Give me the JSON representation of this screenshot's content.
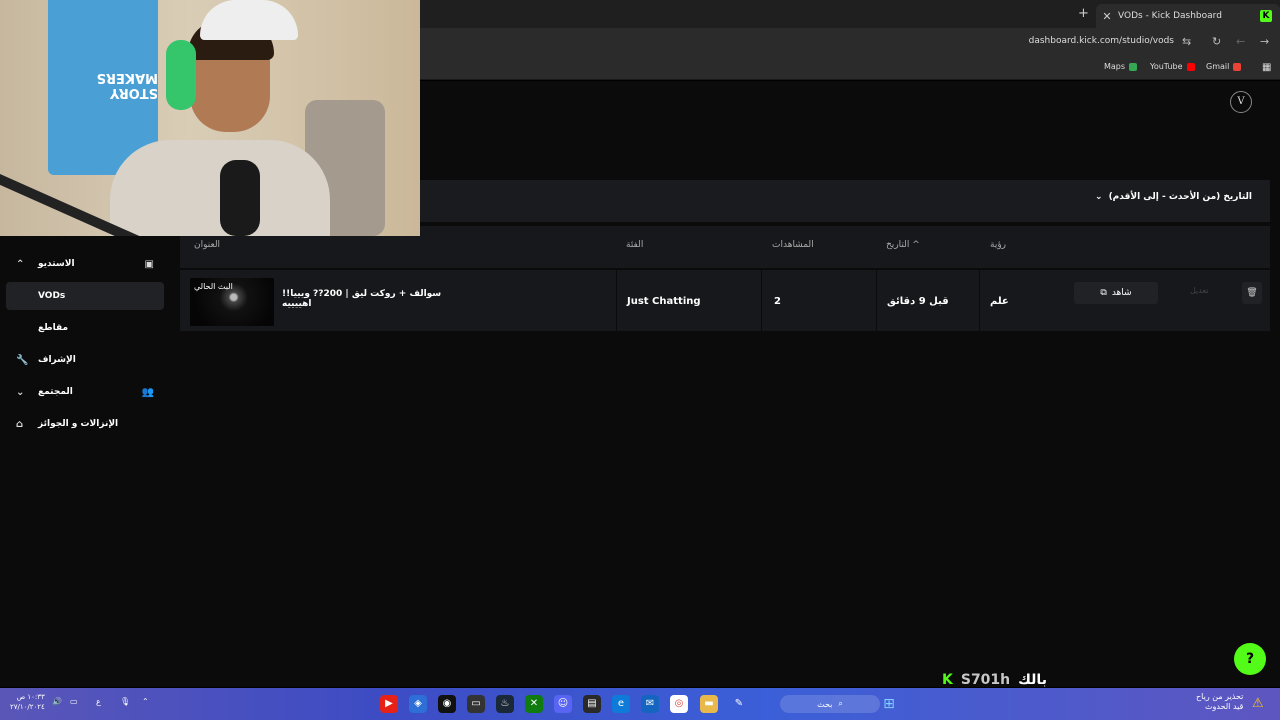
{
  "browser": {
    "tab_title": "VODs - Kick Dashboard",
    "tab_favicon": "K",
    "new_tab": "+",
    "tab_close": "✕",
    "url": "dashboard.kick.com/studio/vods",
    "bookmarks": [
      {
        "label": "Maps",
        "color": "#34a853"
      },
      {
        "label": "YouTube",
        "color": "#ff0000"
      },
      {
        "label": "Gmail",
        "color": "#ea4335"
      }
    ]
  },
  "header": {
    "avatar": "V"
  },
  "filter": {
    "sort_label": "التاريخ (من الأحدث - إلى الأقدم)"
  },
  "table": {
    "columns": {
      "title": "العنوان",
      "category": "الفئة",
      "views": "المشاهدات",
      "date": "التاريخ",
      "visibility": "رؤية"
    },
    "rows": [
      {
        "thumb_label": "البث الحالي",
        "title": "سوالف + روكت ليق | 200?? ويييا!!اهييييه",
        "category": "Just Chatting",
        "views": "2",
        "date": "قبل 9 دقائق",
        "visibility": "علم",
        "watch": "شاهد",
        "edit": "تعديل"
      }
    ]
  },
  "sidebar": {
    "items": [
      {
        "label": "الاستديو"
      },
      {
        "label": "VODs"
      },
      {
        "label": "مقاطع"
      },
      {
        "label": "الإشراف"
      },
      {
        "label": "المجتمع"
      },
      {
        "label": "الإنزالات و الجوائز"
      }
    ]
  },
  "overlay": {
    "shirt_text": "STORY MAKERS",
    "brand_handle": "S701h",
    "brand_name": "بالك",
    "brand_k": "K"
  },
  "taskbar": {
    "search_label": "بحث",
    "clock_time": "١٠:٣٣ ص",
    "clock_date": "٢٧/١٠/٢٠٢٤",
    "weather_line1": "تحذير من رياح",
    "weather_line2": "قيد الحدوث",
    "lang": "ع"
  }
}
